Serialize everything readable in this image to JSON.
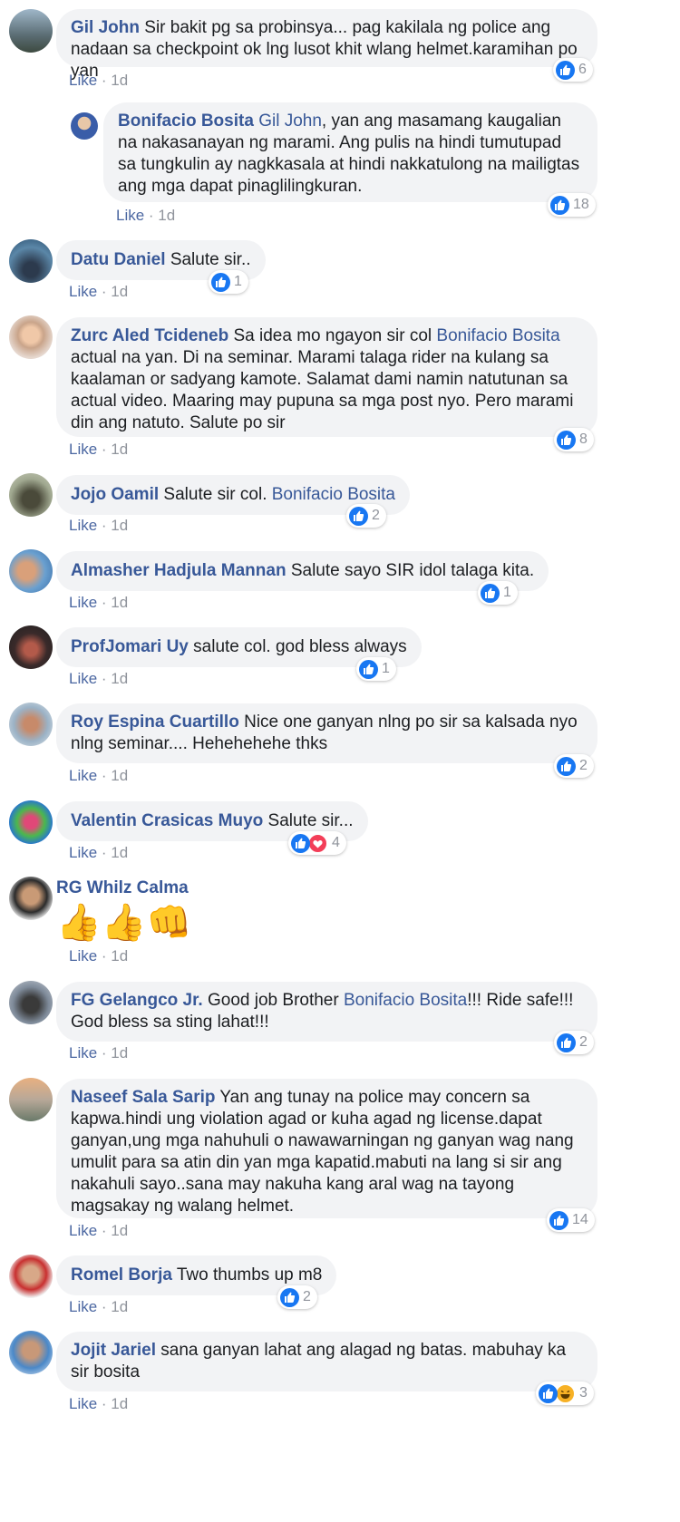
{
  "comments": [
    {
      "author": "Gil John",
      "text": "Sir bakit pg sa probinsya... pag kakilala ng police ang nadaan sa checkpoint ok lng lusot khit wlang helmet.karamihan po yan",
      "like": "Like",
      "time": "1d",
      "count": "6"
    },
    {
      "author": "Bonifacio Bosita",
      "mention": "Gil John",
      "text": ", yan ang masamang kaugalian na nakasanayan ng marami. Ang pulis na hindi tumutupad sa tungkulin ay nagkkasala at hindi nakkatulong na mailigtas ang mga dapat pinaglilingkuran.",
      "like": "Like",
      "time": "1d",
      "count": "18"
    },
    {
      "author": "Datu Daniel",
      "text": "Salute sir..",
      "like": "Like",
      "time": "1d",
      "count": "1"
    },
    {
      "author": "Zurc Aled Tcideneb",
      "text": "Sa idea mo ngayon sir col ",
      "mention": "Bonifacio Bosita",
      "text2": " actual na yan. Di na seminar. Marami talaga rider na kulang sa kaalaman or sadyang kamote. Salamat dami namin natutunan sa actual video. Maaring may pupuna sa mga post nyo. Pero marami din ang natuto. Salute po sir",
      "like": "Like",
      "time": "1d",
      "count": "8"
    },
    {
      "author": "Jojo Oamil",
      "text": "Salute sir col. ",
      "mention": "Bonifacio Bosita",
      "like": "Like",
      "time": "1d",
      "count": "2"
    },
    {
      "author": "Almasher Hadjula Mannan",
      "text": "Salute sayo SIR idol talaga kita.",
      "like": "Like",
      "time": "1d",
      "count": "1"
    },
    {
      "author": "ProfJomari Uy",
      "text": "salute col. god bless always",
      "like": "Like",
      "time": "1d",
      "count": "1"
    },
    {
      "author": "Roy Espina Cuartillo",
      "text": "Nice one ganyan nlng po sir sa kalsada nyo nlng seminar.... Hehehehehe thks",
      "like": "Like",
      "time": "1d",
      "count": "2"
    },
    {
      "author": "Valentin Crasicas Muyo",
      "text": "Salute sir...",
      "like": "Like",
      "time": "1d",
      "count": "4"
    },
    {
      "author": "RG Whilz Calma",
      "text": "👍👍👊",
      "like": "Like",
      "time": "1d"
    },
    {
      "author": "FG Gelangco Jr.",
      "text": "Good job Brother ",
      "mention": "Bonifacio Bosita",
      "text2": "!!! Ride safe!!! God bless sa sting lahat!!!",
      "like": "Like",
      "time": "1d",
      "count": "2"
    },
    {
      "author": "Naseef Sala Sarip",
      "text": "Yan ang tunay na police may concern sa kapwa.hindi ung violation agad or kuha agad ng license.dapat ganyan,ung mga nahuhuli o nawawarningan ng ganyan wag nang umulit para sa atin din yan mga kapatid.mabuti na lang si sir ang nakahuli sayo..sana may nakuha kang aral wag na tayong magsakay ng walang helmet.",
      "like": "Like",
      "time": "1d",
      "count": "14"
    },
    {
      "author": "Romel Borja",
      "text": "Two thumbs up m8",
      "like": "Like",
      "time": "1d",
      "count": "2"
    },
    {
      "author": "Jojit Jariel",
      "text": "sana ganyan lahat ang alagad ng batas. mabuhay ka sir bosita",
      "like": "Like",
      "time": "1d",
      "count": "3"
    }
  ],
  "separator": " · ",
  "colors": {
    "author": "#385898",
    "bubble": "#f2f3f5",
    "like": "#1877f2",
    "love": "#f33e58",
    "haha": "#f7b125"
  }
}
